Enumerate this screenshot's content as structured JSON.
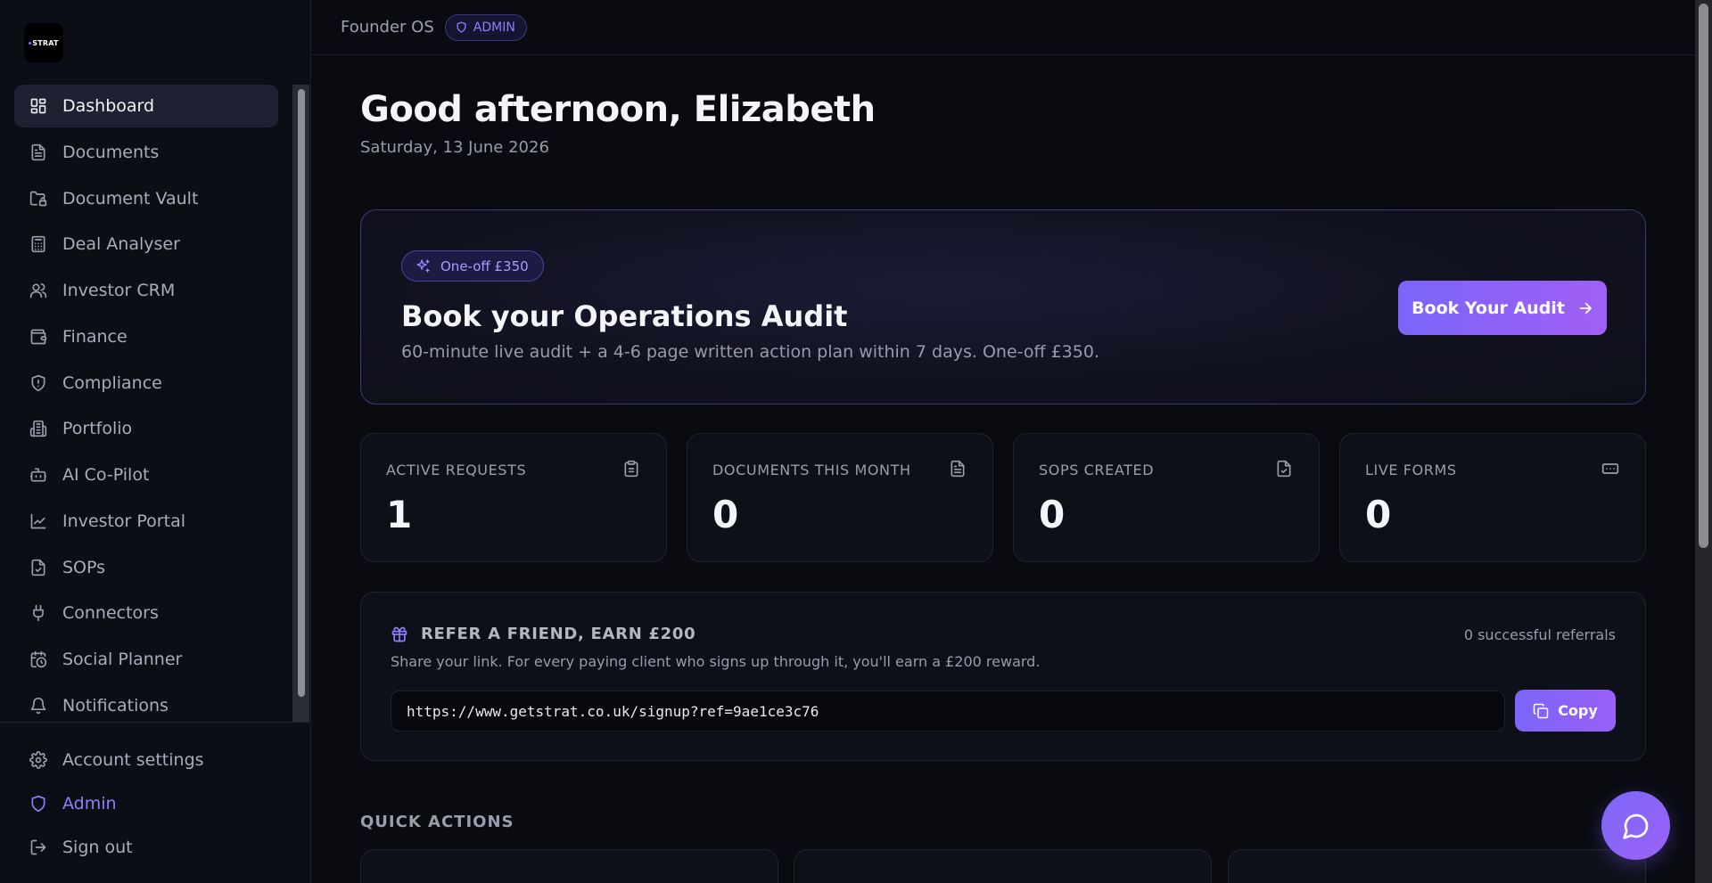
{
  "sidebar": {
    "logo_text": "STRAT",
    "items": [
      {
        "label": "Dashboard",
        "icon": "dashboard-icon",
        "active": true
      },
      {
        "label": "Documents",
        "icon": "document-icon"
      },
      {
        "label": "Document Vault",
        "icon": "folder-lock-icon"
      },
      {
        "label": "Deal Analyser",
        "icon": "calculator-icon"
      },
      {
        "label": "Investor CRM",
        "icon": "users-icon"
      },
      {
        "label": "Finance",
        "icon": "wallet-icon"
      },
      {
        "label": "Compliance",
        "icon": "shield-icon"
      },
      {
        "label": "Portfolio",
        "icon": "building-icon"
      },
      {
        "label": "AI Co-Pilot",
        "icon": "bot-icon"
      },
      {
        "label": "Investor Portal",
        "icon": "line-chart-icon"
      },
      {
        "label": "SOPs",
        "icon": "file-check-icon"
      },
      {
        "label": "Connectors",
        "icon": "plug-icon"
      },
      {
        "label": "Social Planner",
        "icon": "calendar-clock-icon"
      },
      {
        "label": "Notifications",
        "icon": "bell-icon"
      }
    ],
    "bottom": [
      {
        "label": "Account settings",
        "icon": "gear-icon"
      },
      {
        "label": "Admin",
        "icon": "shield-icon"
      },
      {
        "label": "Sign out",
        "icon": "sign-out-icon"
      }
    ]
  },
  "header": {
    "title": "Founder OS",
    "role_badge": "ADMIN"
  },
  "main": {
    "greeting": "Good afternoon, Elizabeth",
    "date": "Saturday, 13 June 2026",
    "audit": {
      "badge": "One-off £350",
      "title": "Book your Operations Audit",
      "description": "60-minute live audit + a 4-6 page written action plan within 7 days. One-off £350.",
      "button": "Book Your Audit"
    },
    "stats": [
      {
        "label": "ACTIVE REQUESTS",
        "value": "1",
        "icon": "clipboard-icon"
      },
      {
        "label": "DOCUMENTS THIS MONTH",
        "value": "0",
        "icon": "document-icon"
      },
      {
        "label": "SOPS CREATED",
        "value": "0",
        "icon": "file-check-icon"
      },
      {
        "label": "LIVE FORMS",
        "value": "0",
        "icon": "form-input-icon"
      }
    ],
    "referral": {
      "title": "REFER A FRIEND, EARN £200",
      "count": "0 successful referrals",
      "description": "Share your link. For every paying client who signs up through it, you'll earn a £200 reward.",
      "link": "https://www.getstrat.co.uk/signup?ref=9ae1ce3c76",
      "copy_label": "Copy"
    },
    "quick_actions": {
      "heading": "QUICK ACTIONS"
    }
  },
  "colors": {
    "accent": "#7b65f8",
    "accent_secondary": "#a05ff6",
    "background": "#090b11",
    "card": "#0e1019"
  }
}
